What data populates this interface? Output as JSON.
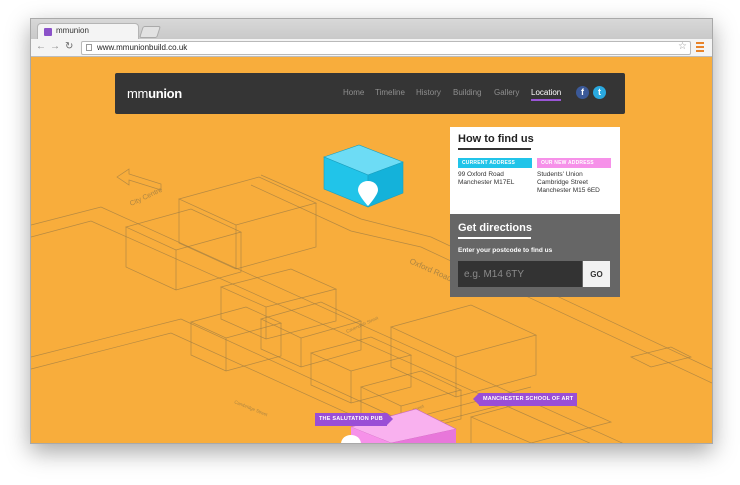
{
  "browser": {
    "tab_title": "mmunion",
    "url": "www.mmunionbuild.co.uk",
    "icons": [
      "back-icon",
      "forward-icon",
      "reload-icon",
      "document-icon",
      "star-icon",
      "menu-icon"
    ]
  },
  "site": {
    "logo_light": "mm",
    "logo_bold": "union",
    "nav": [
      "Home",
      "Timeline",
      "History",
      "Building",
      "Gallery",
      "Location"
    ],
    "active_nav": "Location",
    "social": {
      "facebook": "f",
      "twitter": "t"
    }
  },
  "find": {
    "title": "How to find us",
    "current_label": "CURRENT ADDRESS",
    "current_lines": [
      "99 Oxford Road",
      "Manchester M17EL"
    ],
    "new_label": "OUR NEW ADDRESS",
    "new_lines": [
      "Students' Union",
      "Cambridge Street",
      "Manchester M15 6ED"
    ]
  },
  "directions": {
    "title": "Get directions",
    "prompt": "Enter your postcode to find us",
    "placeholder": "e.g. M14 6TY",
    "button": "GO"
  },
  "map": {
    "labels": {
      "city_centre": "City Centre",
      "oxford_road": "Oxford Road",
      "cavendish_street": "Cavendish Street",
      "cambridge_street": "Cambridge Street",
      "grosvenor_street": "Grosvenor Street"
    },
    "pub": "THE SALUTATION PUB",
    "art_school": "MANCHESTER SCHOOL OF ART"
  },
  "colors": {
    "background": "#f8ad3c",
    "header": "#353535",
    "current_building": "#21c4e9",
    "new_building": "#f691e9",
    "accent": "#9a4ed6"
  }
}
